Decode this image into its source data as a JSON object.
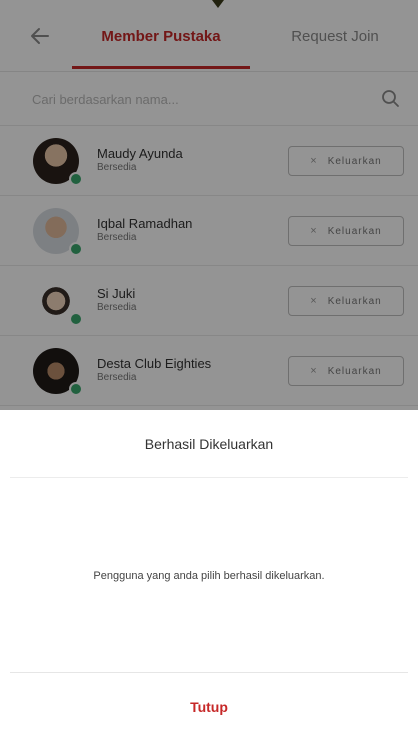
{
  "header": {
    "tabs": [
      {
        "label": "Member Pustaka",
        "active": true
      },
      {
        "label": "Request Join",
        "active": false
      }
    ]
  },
  "search": {
    "placeholder": "Cari berdasarkan nama..."
  },
  "members": [
    {
      "name": "Maudy Ayunda",
      "role": "Bersedia",
      "action": "Keluarkan"
    },
    {
      "name": "Iqbal Ramadhan",
      "role": "Bersedia",
      "action": "Keluarkan"
    },
    {
      "name": "Si Juki",
      "role": "Bersedia",
      "action": "Keluarkan"
    },
    {
      "name": "Desta Club Eighties",
      "role": "Bersedia",
      "action": "Keluarkan"
    }
  ],
  "dialog": {
    "title": "Berhasil Dikeluarkan",
    "message": "Pengguna yang anda pilih berhasil dikeluarkan.",
    "close_label": "Tutup"
  },
  "colors": {
    "accent": "#c62828",
    "verified": "#3aa76d"
  }
}
